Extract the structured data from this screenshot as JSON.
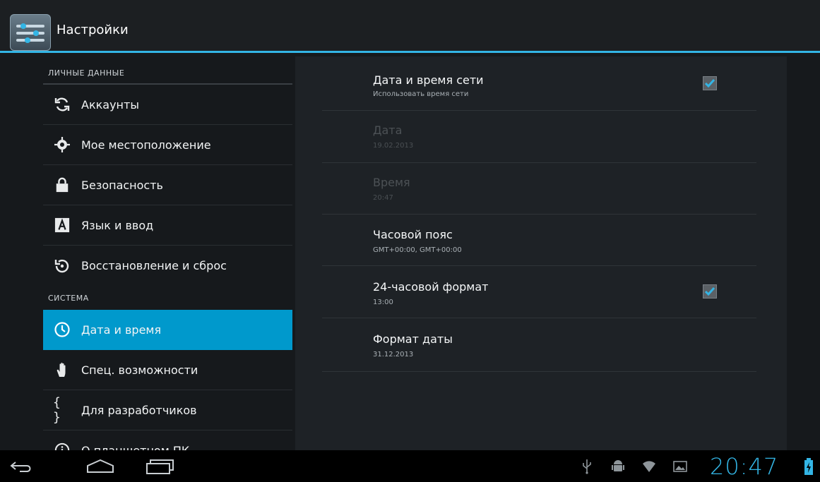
{
  "app": {
    "title": "Настройки"
  },
  "left": {
    "personal_header": "ЛИЧНЫЕ ДАННЫЕ",
    "system_header": "СИСТЕМА",
    "items": [
      {
        "label": "Аккаунты",
        "icon": "sync-icon"
      },
      {
        "label": "Мое местоположение",
        "icon": "location-icon"
      },
      {
        "label": "Безопасность",
        "icon": "lock-icon"
      },
      {
        "label": "Язык и ввод",
        "icon": "keyboard-letter-icon"
      },
      {
        "label": "Восстановление и сброс",
        "icon": "backup-restore-icon"
      },
      {
        "label": "Дата и время",
        "icon": "clock-icon",
        "selected": true
      },
      {
        "label": "Спец. возможности",
        "icon": "hand-icon"
      },
      {
        "label": "Для разработчиков",
        "icon": "braces-icon"
      },
      {
        "label": "О планшетном ПК",
        "icon": "info-icon"
      }
    ]
  },
  "right": {
    "prefs": [
      {
        "title": "Дата и время сети",
        "summary": "Использовать время сети",
        "checkbox": true,
        "checked": true,
        "enabled": true
      },
      {
        "title": "Дата",
        "summary": "19.02.2013",
        "checkbox": false,
        "enabled": false
      },
      {
        "title": "Время",
        "summary": "20:47",
        "checkbox": false,
        "enabled": false
      },
      {
        "title": "Часовой пояс",
        "summary": "GMT+00:00, GMT+00:00",
        "checkbox": false,
        "enabled": true
      },
      {
        "title": "24-часовой формат",
        "summary": "13:00",
        "checkbox": true,
        "checked": true,
        "enabled": true
      },
      {
        "title": "Формат даты",
        "summary": "31.12.2013",
        "checkbox": false,
        "enabled": true
      }
    ]
  },
  "statusbar": {
    "time": "20:47"
  },
  "colors": {
    "accent": "#33b5e5",
    "selected": "#0099cc"
  }
}
